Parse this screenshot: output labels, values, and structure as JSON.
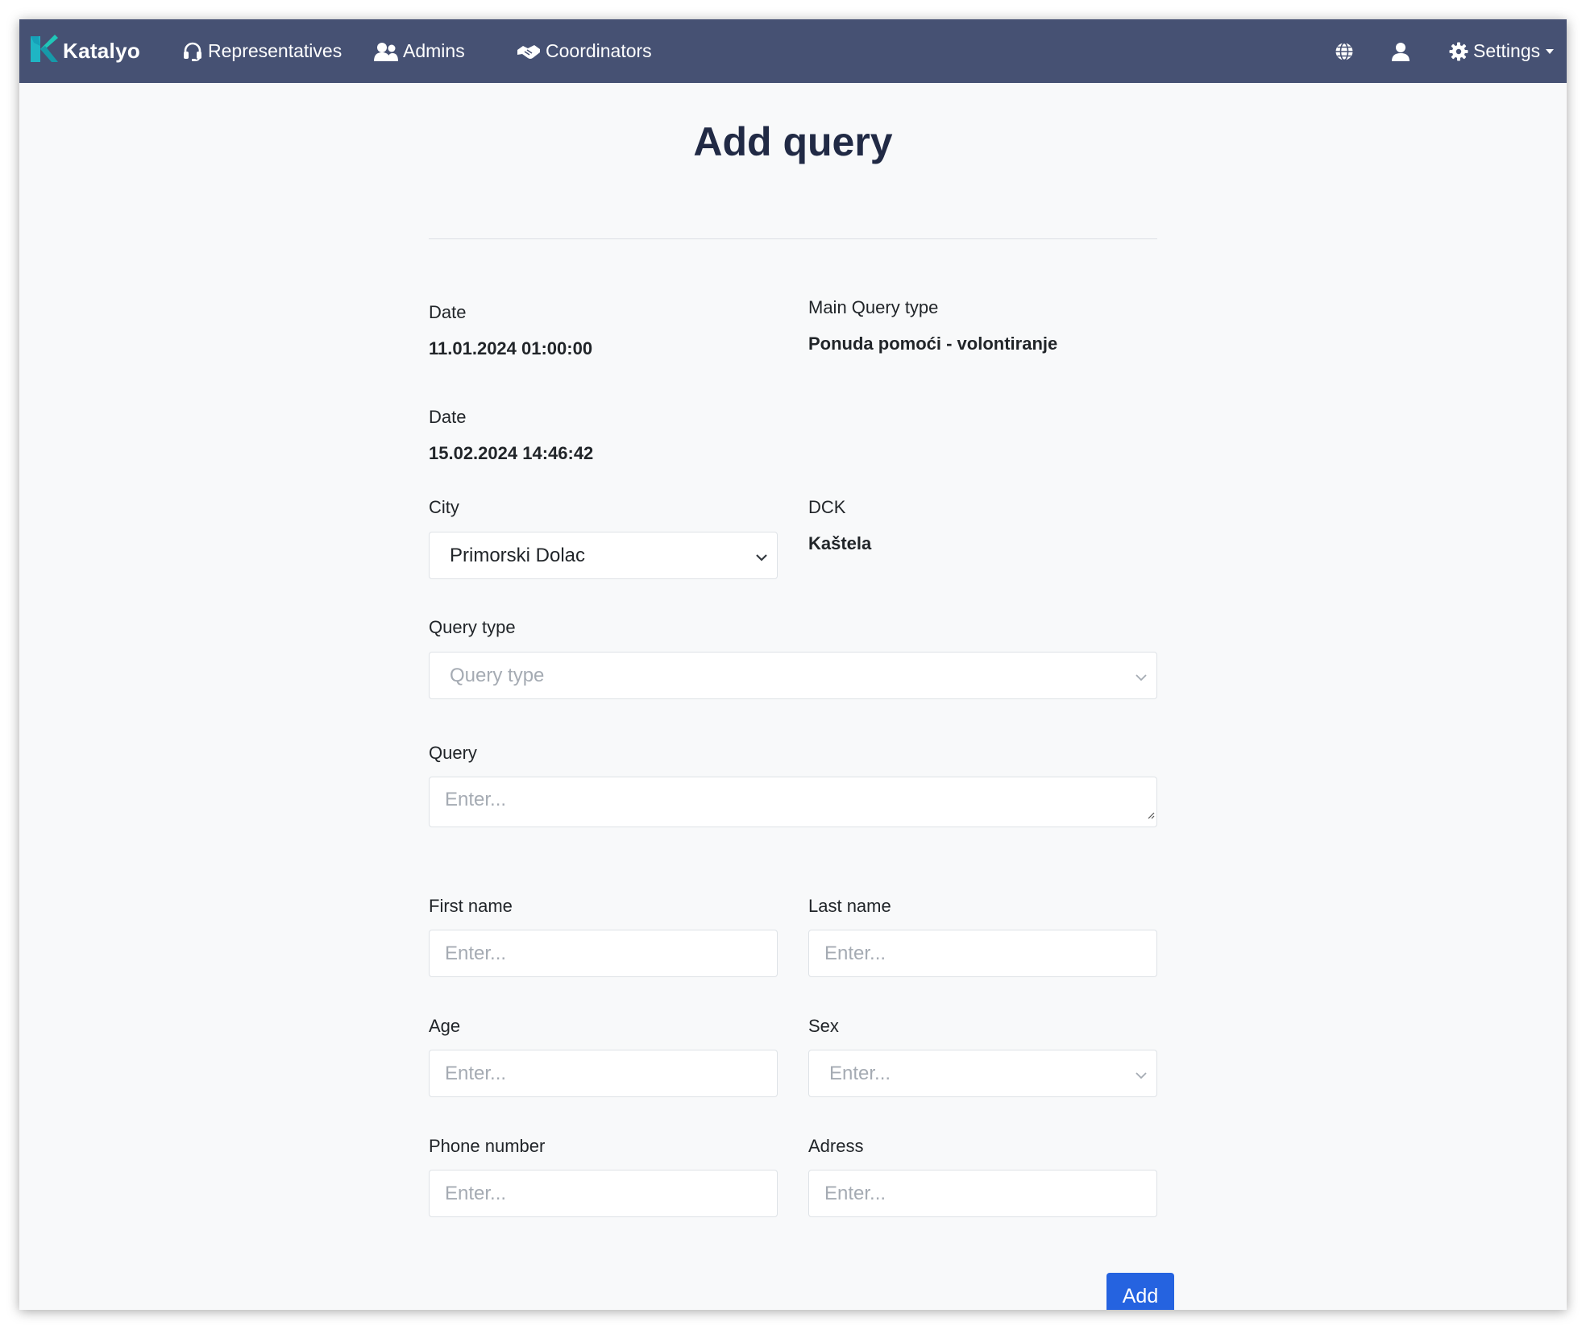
{
  "app": {
    "brand": "Katalyo",
    "colors": {
      "navbar": "#465173",
      "primary": "#2563e0",
      "brand_accent": "#1fb5c4"
    }
  },
  "nav": {
    "items": [
      {
        "label": "Representatives",
        "icon": "headset-icon"
      },
      {
        "label": "Admins",
        "icon": "users-icon"
      },
      {
        "label": "Coordinators",
        "icon": "handshake-icon"
      }
    ],
    "right": {
      "language_icon": "globe-icon",
      "user_icon": "user-icon",
      "settings": {
        "label": "Settings",
        "icon": "gear-icon"
      }
    }
  },
  "page": {
    "title": "Add query"
  },
  "form": {
    "date1": {
      "label": "Date",
      "value": "11.01.2024 01:00:00"
    },
    "main_query_type": {
      "label": "Main Query type",
      "value": "Ponuda pomoći - volontiranje"
    },
    "date2": {
      "label": "Date",
      "value": "15.02.2024 14:46:42"
    },
    "city": {
      "label": "City",
      "value": "Primorski Dolac"
    },
    "dck": {
      "label": "DCK",
      "value": "Kaštela"
    },
    "query_type": {
      "label": "Query type",
      "placeholder": "Query type"
    },
    "query": {
      "label": "Query",
      "placeholder": "Enter..."
    },
    "first_name": {
      "label": "First name",
      "placeholder": "Enter..."
    },
    "last_name": {
      "label": "Last name",
      "placeholder": "Enter..."
    },
    "age": {
      "label": "Age",
      "placeholder": "Enter..."
    },
    "sex": {
      "label": "Sex",
      "placeholder": "Enter..."
    },
    "phone": {
      "label": "Phone number",
      "placeholder": "Enter..."
    },
    "address": {
      "label": "Adress",
      "placeholder": "Enter..."
    },
    "submit_label": "Add"
  }
}
